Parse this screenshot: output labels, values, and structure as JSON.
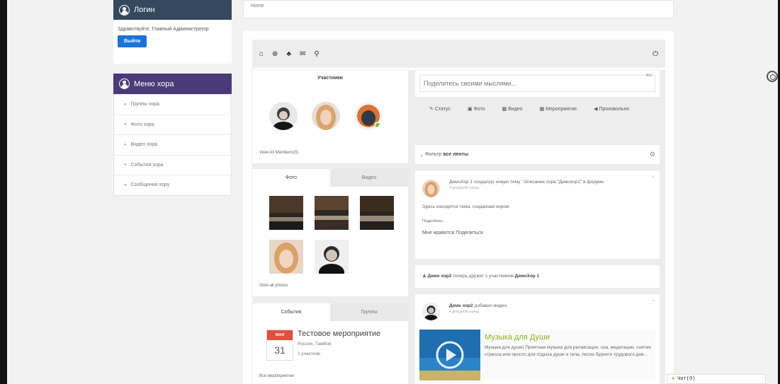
{
  "login": {
    "title": "Логин",
    "greeting": "Здравствуйте, Главный Администратор",
    "logout": "Выйти"
  },
  "menu": {
    "title": "Меню хора",
    "items": [
      {
        "label": "Группы хора"
      },
      {
        "label": "Фото хора"
      },
      {
        "label": "Видео хора"
      },
      {
        "label": "События хора"
      },
      {
        "label": "Сообщения хору"
      }
    ]
  },
  "breadcrumb": "Home",
  "members": {
    "title": "Участники",
    "view_all": "View All Members(3)"
  },
  "media_tabs": {
    "photo": "Фото",
    "video": "Видео",
    "view_all": "View all photos"
  },
  "event_tabs": {
    "events": "События",
    "groups": "Группы"
  },
  "event": {
    "month": "МАЯ",
    "day": "31",
    "title": "Тестовое мероприятие",
    "location": "Россия, Тамбов",
    "participants": "1 участник",
    "all": "Все мероприятия"
  },
  "share": {
    "placeholder": "Поделитесь своими мыслями...",
    "counter": "400",
    "options": {
      "status": "Статус",
      "photo": "Фото",
      "video": "Видео",
      "event": "Мероприятие",
      "custom": "Произвольно"
    }
  },
  "filter": {
    "label": "Фильтр",
    "value": "все ленты"
  },
  "post1": {
    "text": "ДемоХор 1 создал(а) новую тему ' Описание хора \"Демохор1\" в форуме.",
    "time": "4 дня(дней) назад",
    "body": "Здесь находится тема, созданная хором",
    "more": "Подробнее...",
    "like": "Мне нравится",
    "share": "Поделиться"
  },
  "friend": {
    "user1": "Демо хор2",
    "mid": "теперь дружит с участником",
    "user2": "ДемоХор 1"
  },
  "post2": {
    "user": "Демо хор2",
    "action": "добавил видео.",
    "time": "4 дня(дней) назад",
    "video_title": "Музыка для Души",
    "video_desc": "Музыка для души! Приятная музыка для релаксации, сна, медитации, снятия стресса или просто для отдыха души и тела, после бурного трудового дня..."
  },
  "chat": "Чат(0)",
  "colors": {
    "login_header": "#34495e",
    "menu_header": "#4a3b78",
    "button": "#1a73d9",
    "calendar": "#e74c3c",
    "video_title": "#8db21e"
  }
}
